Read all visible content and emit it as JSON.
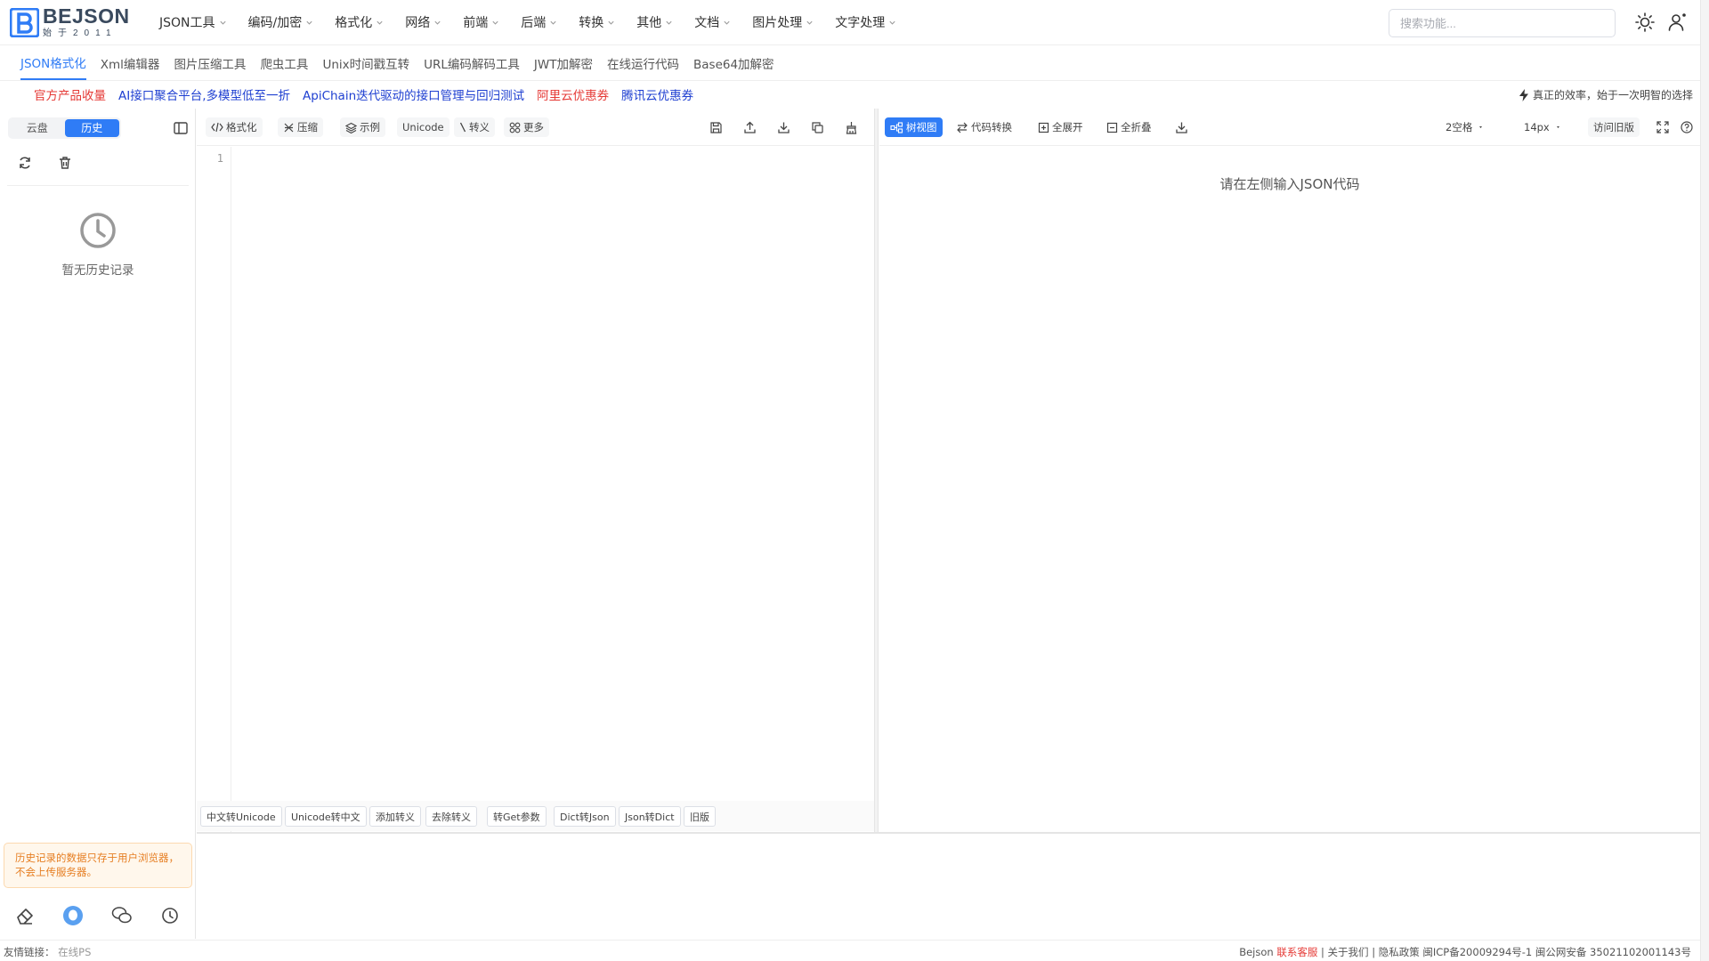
{
  "header": {
    "logo_title": "BEJSON",
    "logo_sub": "始于2011",
    "nav": [
      "JSON工具",
      "编码/加密",
      "格式化",
      "网络",
      "前端",
      "后端",
      "转换",
      "其他",
      "文档",
      "图片处理",
      "文字处理"
    ],
    "search_placeholder": "搜索功能..."
  },
  "tabs": [
    "JSON格式化",
    "Xml编辑器",
    "图片压缩工具",
    "爬虫工具",
    "Unix时间戳互转",
    "URL编码解码工具",
    "JWT加解密",
    "在线运行代码",
    "Base64加解密"
  ],
  "promo": {
    "links": [
      {
        "label": "官方产品收量",
        "color": "red"
      },
      {
        "label": "AI接口聚合平台,多模型低至一折",
        "color": "blue"
      },
      {
        "label": "ApiChain迭代驱动的接口管理与回归测试",
        "color": "blue"
      },
      {
        "label": "阿里云优惠券",
        "color": "red"
      },
      {
        "label": "腾讯云优惠券",
        "color": "blue"
      }
    ],
    "slogan": "真正的效率，始于一次明智的选择"
  },
  "sidebar": {
    "seg_cloud": "云盘",
    "seg_history": "历史",
    "empty_text": "暂无历史记录",
    "notice": "历史记录的数据只存于用户浏览器，不会上传服务器。"
  },
  "editor": {
    "tools": [
      "格式化",
      "压缩",
      "示例",
      "Unicode",
      "转义",
      "更多"
    ],
    "line_number": "1",
    "bottom_buttons": [
      "中文转Unicode",
      "Unicode转中文",
      "添加转义",
      "去除转义",
      "转Get参数",
      "Dict转Json",
      "Json转Dict",
      "旧版"
    ]
  },
  "result": {
    "tree_view": "树视图",
    "code_convert": "代码转换",
    "expand_all": "全展开",
    "collapse_all": "全折叠",
    "indent": "2空格",
    "font_size": "14px",
    "old_version": "访问旧版",
    "placeholder": "请在左侧输入JSON代码"
  },
  "footer": {
    "friend_label": "友情链接：",
    "friend_link": "在线PS",
    "brand": "Bejson",
    "contact": "联系客服",
    "rest": "| 关于我们 | 隐私政策 闽ICP备20009294号-1 闽公网安备 35021102001143号"
  },
  "colors": {
    "accent": "#2f7cf6",
    "promo_red": "#e53935",
    "promo_blue": "#1e3fd1",
    "notice": "#e67e22"
  }
}
